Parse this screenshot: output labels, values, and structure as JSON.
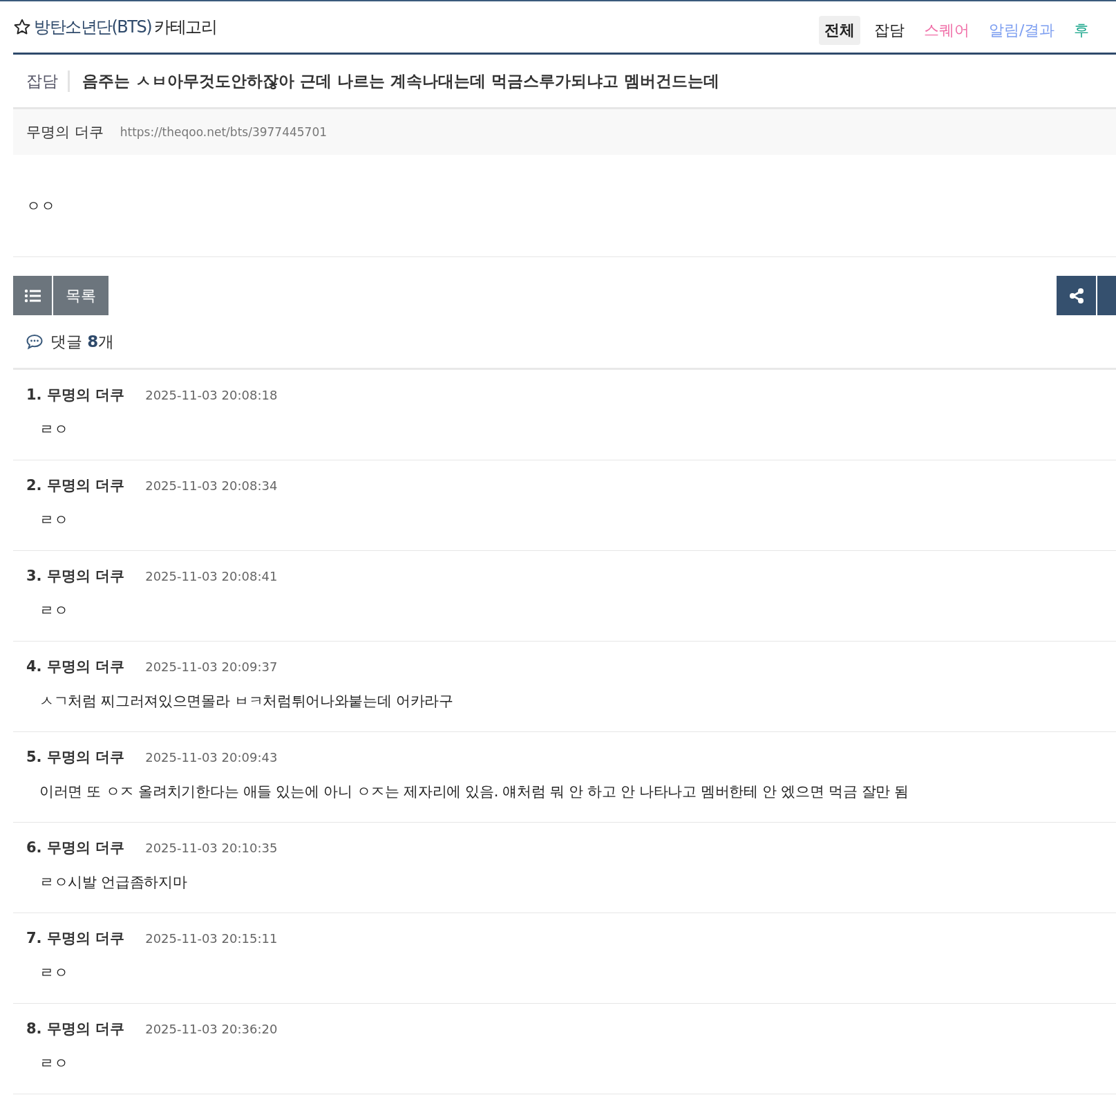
{
  "header": {
    "category_prefix": "방탄소년단(BTS)",
    "category_suffix": "카테고리"
  },
  "tabs": [
    {
      "label": "전체",
      "selected": true,
      "color": "#222222"
    },
    {
      "label": "잡담",
      "selected": false,
      "color": "#222222"
    },
    {
      "label": "스퀘어",
      "selected": false,
      "color": "#f06fa8"
    },
    {
      "label": "알림/결과",
      "selected": false,
      "color": "#7b9df0"
    },
    {
      "label": "후",
      "selected": false,
      "color": "#17a58a"
    }
  ],
  "post": {
    "category": "잡담",
    "title": "음주는 ㅅㅂ아무것도안하잖아 근데 나르는 계속나대는데 먹금스루가되냐고 멤버건드는데",
    "author": "무명의 더쿠",
    "url": "https://theqoo.net/bts/3977445701",
    "body": "ㅇㅇ"
  },
  "list_button": "목록",
  "comments_header": {
    "label": "댓글",
    "count": "8",
    "unit": "개"
  },
  "comments": [
    {
      "number": "1.",
      "author": "무명의 더쿠",
      "time": "2025-11-03 20:08:18",
      "text": "ㄹㅇ"
    },
    {
      "number": "2.",
      "author": "무명의 더쿠",
      "time": "2025-11-03 20:08:34",
      "text": "ㄹㅇ"
    },
    {
      "number": "3.",
      "author": "무명의 더쿠",
      "time": "2025-11-03 20:08:41",
      "text": "ㄹㅇ"
    },
    {
      "number": "4.",
      "author": "무명의 더쿠",
      "time": "2025-11-03 20:09:37",
      "text": "ㅅㄱ처럼 찌그러져있으면몰라 ㅂㅋ처럼튀어나와붙는데 어카라구"
    },
    {
      "number": "5.",
      "author": "무명의 더쿠",
      "time": "2025-11-03 20:09:43",
      "text": "이러면 또 ㅇㅈ 올려치기한다는 애들 있는에 아니 ㅇㅈ는 제자리에 있음. 얘처럼 뭐 안 하고 안 나타나고 멤버한테 안 엤으면 먹금 잘만 됨"
    },
    {
      "number": "6.",
      "author": "무명의 더쿠",
      "time": "2025-11-03 20:10:35",
      "text": "ㄹㅇ시발 언급좀하지마"
    },
    {
      "number": "7.",
      "author": "무명의 더쿠",
      "time": "2025-11-03 20:15:11",
      "text": "ㄹㅇ"
    },
    {
      "number": "8.",
      "author": "무명의 더쿠",
      "time": "2025-11-03 20:36:20",
      "text": "ㄹㅇ"
    }
  ]
}
